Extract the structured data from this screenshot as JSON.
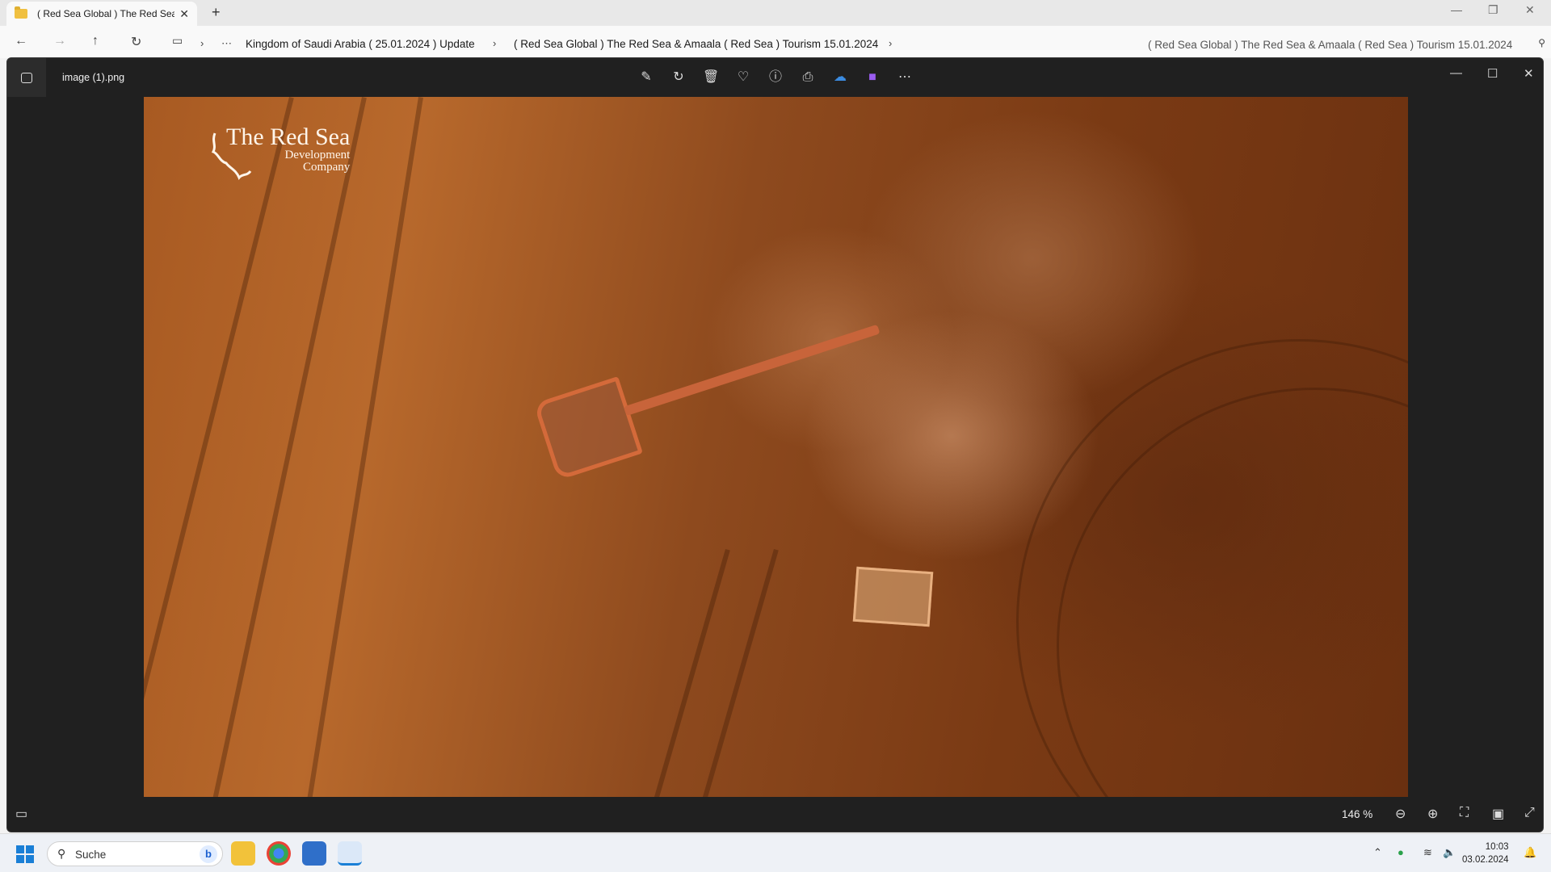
{
  "explorer": {
    "tab_title": "( Red Sea Global ) The Red Sea",
    "breadcrumb": [
      "Kingdom of Saudi Arabia ( 25.01.2024 ) Update",
      "( Red Sea Global ) The Red Sea & Amaala ( Red Sea ) Tourism 15.01.2024"
    ],
    "search_text": "( Red Sea Global ) The Red Sea & Amaala ( Red Sea ) Tourism 15.01.2024",
    "overflow_label": "⋯"
  },
  "photos": {
    "file_name": "image (1).png",
    "zoom_label": "146 %",
    "watermark": {
      "line1": "The Red Sea",
      "line2": "Development",
      "line3": "Company"
    }
  },
  "taskbar": {
    "search_placeholder": "Suche",
    "time": "10:03",
    "date": "03.02.2024"
  },
  "colors": {
    "accent": "#1a7fd6",
    "viewer_bg": "#202020",
    "sand": "#a85a22"
  }
}
